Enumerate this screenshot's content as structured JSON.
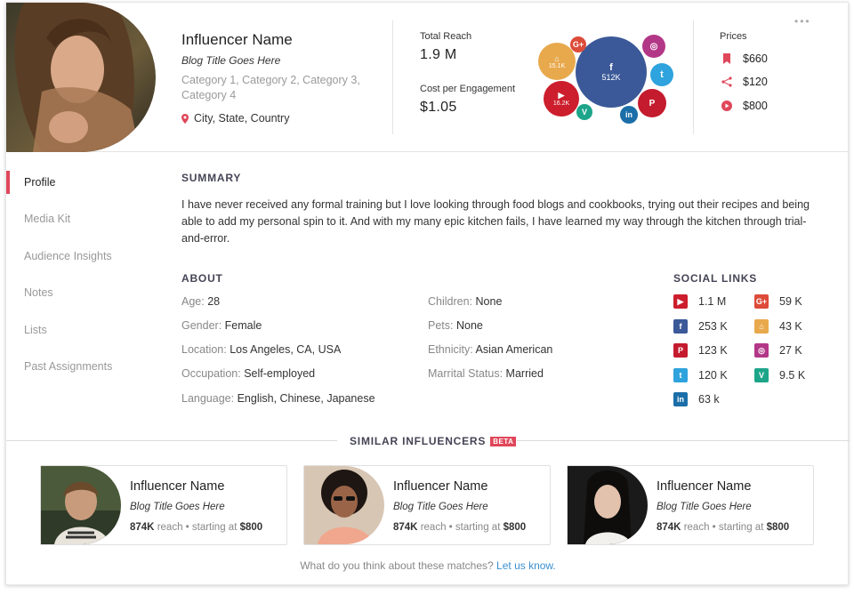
{
  "profile": {
    "name": "Influencer Name",
    "blog_title": "Blog Title Goes Here",
    "categories": "Category 1, Category 2, Category 3, Category 4",
    "location": "City, State, Country"
  },
  "stats": {
    "total_reach_label": "Total Reach",
    "total_reach_value": "1.9 M",
    "cpe_label": "Cost per Engagement",
    "cpe_value": "$1.05"
  },
  "reach_bubbles": [
    {
      "network": "facebook",
      "icon": "f",
      "value": "512K",
      "color": "#3b5998"
    },
    {
      "network": "home",
      "icon": "⌂",
      "value": "15.1K",
      "color": "#e8a94d"
    },
    {
      "network": "youtube",
      "icon": "▶",
      "value": "16.2K",
      "color": "#cc1e2c"
    },
    {
      "network": "google-plus",
      "icon": "G+",
      "value": "",
      "color": "#dd4b39"
    },
    {
      "network": "instagram",
      "icon": "◎",
      "value": "",
      "color": "#b33787"
    },
    {
      "network": "twitter",
      "icon": "t",
      "value": "",
      "color": "#2ea3dd"
    },
    {
      "network": "pinterest",
      "icon": "P",
      "value": "",
      "color": "#c41b2e"
    },
    {
      "network": "linkedin",
      "icon": "in",
      "value": "",
      "color": "#1b6ea8"
    },
    {
      "network": "vine",
      "icon": "V",
      "value": "",
      "color": "#1da58a"
    }
  ],
  "prices": {
    "title": "Prices",
    "items": [
      {
        "icon": "bookmark-icon",
        "value": "$660"
      },
      {
        "icon": "share-icon",
        "value": "$120"
      },
      {
        "icon": "play-icon",
        "value": "$800"
      }
    ]
  },
  "menu_dots": "•••",
  "sidebar": {
    "items": [
      {
        "label": "Profile",
        "active": true
      },
      {
        "label": "Media Kit",
        "active": false
      },
      {
        "label": "Audience Insights",
        "active": false
      },
      {
        "label": "Notes",
        "active": false
      },
      {
        "label": "Lists",
        "active": false
      },
      {
        "label": "Past Assignments",
        "active": false
      }
    ]
  },
  "summary": {
    "title": "SUMMARY",
    "text": "I have never received any formal training but I love looking through food blogs and cookbooks, trying out their recipes and being able to add my personal spin to it. And with my many epic kitchen fails, I have learned my way through the kitchen through trial-and-error."
  },
  "about": {
    "title": "ABOUT",
    "left": [
      {
        "key": "Age:",
        "value": "28"
      },
      {
        "key": "Gender:",
        "value": "Female"
      },
      {
        "key": "Location:",
        "value": "Los Angeles, CA, USA"
      },
      {
        "key": "Occupation:",
        "value": "Self-employed"
      },
      {
        "key": "Language:",
        "value": "English, Chinese, Japanese"
      }
    ],
    "right": [
      {
        "key": "Children:",
        "value": "None"
      },
      {
        "key": "Pets:",
        "value": "None"
      },
      {
        "key": "Ethnicity:",
        "value": "Asian American"
      },
      {
        "key": "Marrital Status:",
        "value": "Married"
      }
    ]
  },
  "social": {
    "title": "SOCIAL LINKS",
    "left": [
      {
        "network": "youtube",
        "icon": "▶",
        "color": "#cc1e2c",
        "value": "1.1 M"
      },
      {
        "network": "facebook",
        "icon": "f",
        "color": "#3b5998",
        "value": "253 K"
      },
      {
        "network": "pinterest",
        "icon": "P",
        "color": "#c41b2e",
        "value": "123 K"
      },
      {
        "network": "twitter",
        "icon": "t",
        "color": "#2ea3dd",
        "value": "120 K"
      },
      {
        "network": "linkedin",
        "icon": "in",
        "color": "#1b6ea8",
        "value": "63 k"
      }
    ],
    "right": [
      {
        "network": "google-plus",
        "icon": "G+",
        "color": "#dd4b39",
        "value": "59 K"
      },
      {
        "network": "home",
        "icon": "⌂",
        "color": "#e8a94d",
        "value": "43 K"
      },
      {
        "network": "instagram",
        "icon": "◎",
        "color": "#b33787",
        "value": "27 K"
      },
      {
        "network": "vine",
        "icon": "V",
        "color": "#1da58a",
        "value": "9.5 K"
      }
    ]
  },
  "similar": {
    "title": "SIMILAR INFLUENCERS",
    "badge": "BETA",
    "cards": [
      {
        "name": "Influencer Name",
        "blog": "Blog Title Goes Here",
        "reach": "874K",
        "reach_suffix": "reach • starting at",
        "price": "$800"
      },
      {
        "name": "Influencer Name",
        "blog": "Blog Title Goes Here",
        "reach": "874K",
        "reach_suffix": "reach • starting at",
        "price": "$800"
      },
      {
        "name": "Influencer Name",
        "blog": "Blog Title Goes Here",
        "reach": "874K",
        "reach_suffix": "reach • starting at",
        "price": "$800"
      }
    ],
    "feedback_text": "What do you think about these matches?",
    "feedback_link": "Let us know."
  }
}
